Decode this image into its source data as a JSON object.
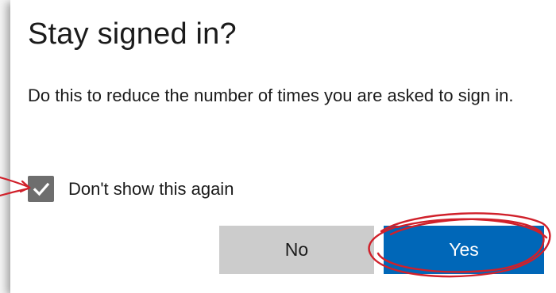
{
  "dialog": {
    "title": "Stay signed in?",
    "description": "Do this to reduce the number of times you are asked to sign in.",
    "checkbox_label": "Don't show this again",
    "checkbox_checked": true,
    "no_label": "No",
    "yes_label": "Yes"
  },
  "colors": {
    "primary": "#0067b8",
    "secondary": "#cccccc",
    "checkbox": "#6e6e6e",
    "annotation": "#d0202a"
  }
}
